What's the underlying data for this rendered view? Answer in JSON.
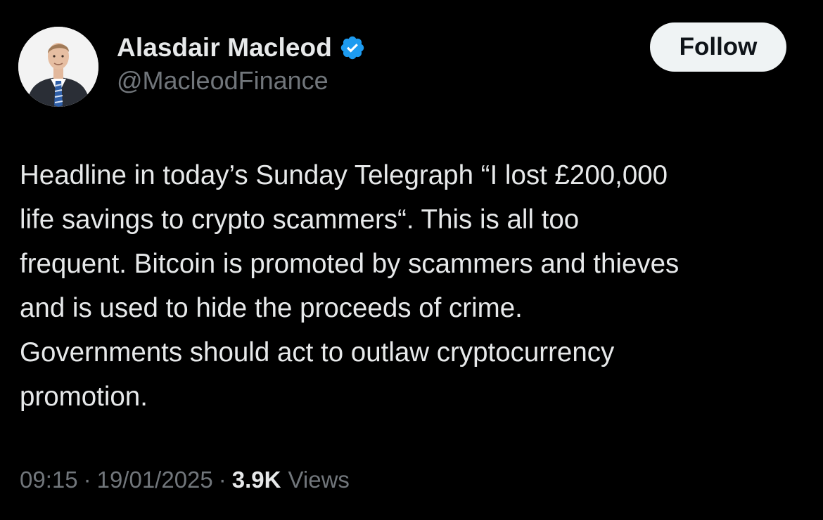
{
  "author": {
    "display_name": "Alasdair Macleod",
    "handle": "@MacleodFinance",
    "verified": true,
    "verified_color": "#1d9bf0"
  },
  "follow_button": {
    "label": "Follow"
  },
  "tweet": {
    "text": "Headline in today’s Sunday Telegraph “I lost £200,000\nlife savings to crypto scammers“. This is all too\nfrequent. Bitcoin is promoted by scammers and thieves\nand is used to hide the proceeds of crime.\nGovernments should act to outlaw cryptocurrency\npromotion."
  },
  "meta": {
    "time": "09:15",
    "separator": "·",
    "date": "19/01/2025",
    "views_count": "3.9K",
    "views_label": "Views"
  },
  "colors": {
    "background": "#000000",
    "primary_text": "#e7e9ea",
    "secondary_text": "#71767b",
    "button_bg": "#eff3f4"
  }
}
